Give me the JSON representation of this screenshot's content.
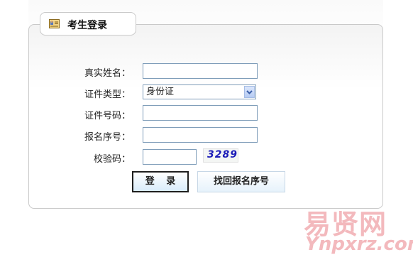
{
  "header": {
    "title": "考生登录",
    "icon": "id-card-icon"
  },
  "form": {
    "name_label": "真实姓名：",
    "name_value": "",
    "id_type_label": "证件类型：",
    "id_type_value": "身份证",
    "id_number_label": "证件号码：",
    "id_number_value": "",
    "reg_number_label": "报名序号：",
    "reg_number_value": "",
    "captcha_label": "校验码：",
    "captcha_value": "",
    "captcha_text": "3289"
  },
  "buttons": {
    "login": "登 录",
    "find_reg": "找回报名序号"
  },
  "watermark": {
    "cn": "易贤网",
    "en": "Ynpxrz.com"
  }
}
